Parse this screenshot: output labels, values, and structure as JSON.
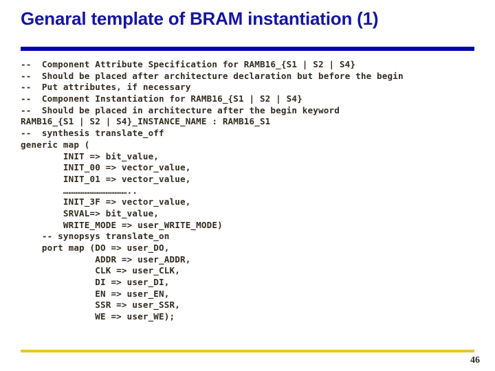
{
  "slide": {
    "title": "Genaral template of BRAM instantiation (1)",
    "page_number": "46",
    "colors": {
      "title": "#1515a3",
      "top_rule": "#0000b0",
      "bottom_rule": "#ecc61e",
      "code_text": "#332a1f",
      "background": "#ffffff"
    },
    "code_lines": [
      "--  Component Attribute Specification for RAMB16_{S1 | S2 | S4}",
      "--  Should be placed after architecture declaration but before the begin",
      "--  Put attributes, if necessary",
      "--  Component Instantiation for RAMB16_{S1 | S2 | S4}",
      "--  Should be placed in architecture after the begin keyword",
      "RAMB16_{S1 | S2 | S4}_INSTANCE_NAME : RAMB16_S1",
      "--  synthesis translate_off",
      "generic map (",
      "        INIT => bit_value,",
      "        INIT_00 => vector_value,",
      "        INIT_01 => vector_value,",
      "        ………………………………..",
      "        INIT_3F => vector_value,",
      "        SRVAL=> bit_value,",
      "        WRITE_MODE => user_WRITE_MODE)",
      "    -- synopsys translate_on",
      "    port map (DO => user_DO,",
      "              ADDR => user_ADDR,",
      "              CLK => user_CLK,",
      "              DI => user_DI,",
      "              EN => user_EN,",
      "              SSR => user_SSR,",
      "              WE => user_WE);"
    ]
  }
}
